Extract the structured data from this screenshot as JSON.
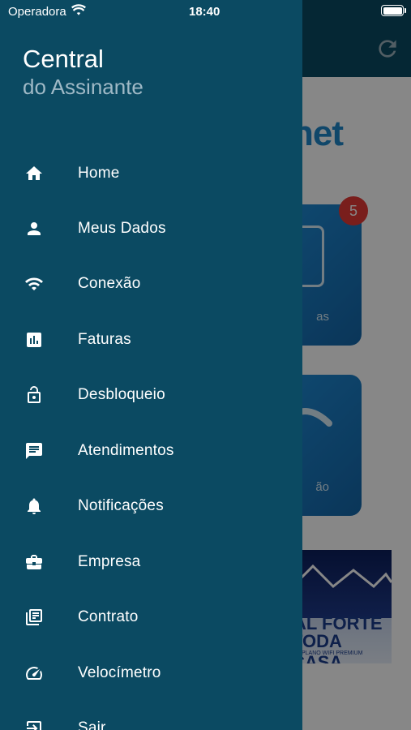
{
  "status_bar": {
    "carrier": "Operadora",
    "time": "18:40"
  },
  "drawer": {
    "title": "Central",
    "subtitle": "do Assinante",
    "items": [
      {
        "label": "Home",
        "icon": "home-icon"
      },
      {
        "label": "Meus Dados",
        "icon": "person-icon"
      },
      {
        "label": "Conexão",
        "icon": "wifi-icon"
      },
      {
        "label": "Faturas",
        "icon": "bar-chart-icon"
      },
      {
        "label": "Desbloqueio",
        "icon": "lock-open-icon"
      },
      {
        "label": "Atendimentos",
        "icon": "chat-icon"
      },
      {
        "label": "Notificações",
        "icon": "bell-icon"
      },
      {
        "label": "Empresa",
        "icon": "briefcase-icon"
      },
      {
        "label": "Contrato",
        "icon": "library-books-icon"
      },
      {
        "label": "Velocímetro",
        "icon": "speedometer-icon"
      },
      {
        "label": "Sair",
        "icon": "exit-icon"
      }
    ]
  },
  "background": {
    "brand_partial": "net",
    "badge_count": "5",
    "card1_label_partial": "as",
    "card2_label_partial": "ão",
    "banner_line1": "AL FORTE",
    "banner_line2": "TODA CASA",
    "banner_line3": "PLANO WIFI PREMIUM"
  },
  "colors": {
    "drawer_bg": "#0b4a62",
    "accent_blue": "#1f86c8",
    "badge_red": "#e53935",
    "subtitle": "#9fb9c6"
  }
}
